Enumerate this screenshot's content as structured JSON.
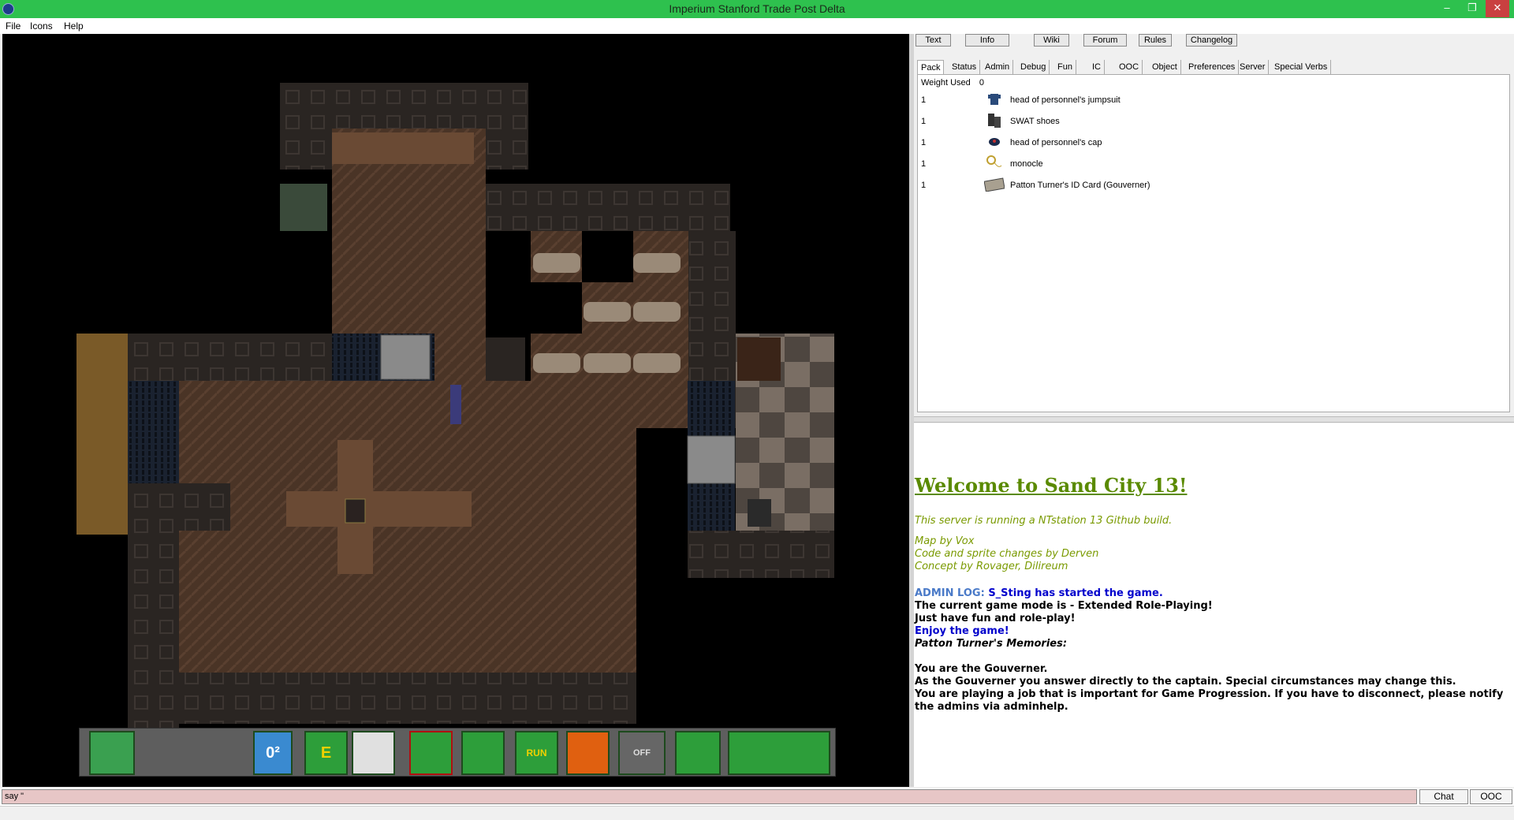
{
  "window": {
    "title": "Imperium Stanford Trade Post Delta",
    "min": "–",
    "max": "❐",
    "close": "✕"
  },
  "menu": [
    "File",
    "Icons",
    "Help"
  ],
  "topbuttons": [
    "Text",
    "Info",
    "Wiki",
    "Forum",
    "Rules",
    "Changelog"
  ],
  "tabs": [
    "Pack",
    "Status",
    "Admin",
    "Debug",
    "Fun",
    "IC",
    "OOC",
    "Object",
    "Preferences",
    "Server",
    "Special Verbs"
  ],
  "pack": {
    "weight_label": "Weight Used",
    "weight_value": "0",
    "items": [
      {
        "qty": "1",
        "name": "head of personnel's jumpsuit",
        "icon": "jumpsuit-icon"
      },
      {
        "qty": "1",
        "name": "SWAT shoes",
        "icon": "shoes-icon"
      },
      {
        "qty": "1",
        "name": "head of personnel's cap",
        "icon": "cap-icon"
      },
      {
        "qty": "1",
        "name": "monocle",
        "icon": "monocle-icon"
      },
      {
        "qty": "1",
        "name": "Patton Turner's ID Card (Gouverner)",
        "icon": "id-card-icon"
      }
    ]
  },
  "output": {
    "welcome": "Welcome to Sand City 13!",
    "build": "This server is running a NTstation 13 Github build.",
    "credits": [
      "Map by Vox",
      "Code and sprite changes by Derven",
      "Concept by Rovager, Dilireum"
    ],
    "admin_prefix": "ADMIN LOG:",
    "admin_msg": "S_Sting has started the game.",
    "mode": "The current game mode is - Extended Role-Playing!",
    "fun": "Just have fun and role-play!",
    "enjoy": "Enjoy the game!",
    "memories": "Patton Turner's Memories:",
    "you_are": "You are the Gouverner.",
    "answer": "As the Gouverner you answer directly to the captain. Special circumstances may change this.",
    "playing": "You are playing a job that is important for Game Progression. If you have to disconnect, please notify",
    "playing2": "the admins via adminhelp."
  },
  "input": {
    "value": "say \"",
    "chat": "Chat",
    "ooc": "OOC"
  },
  "hud": {
    "o2": "0²",
    "e": "E",
    "run": "RUN",
    "off": "OFF"
  },
  "colors": {
    "titlebar": "#2ec14e",
    "welcome": "#5a8a00",
    "admin": "#0000cc",
    "input": "#e7c6c6"
  }
}
